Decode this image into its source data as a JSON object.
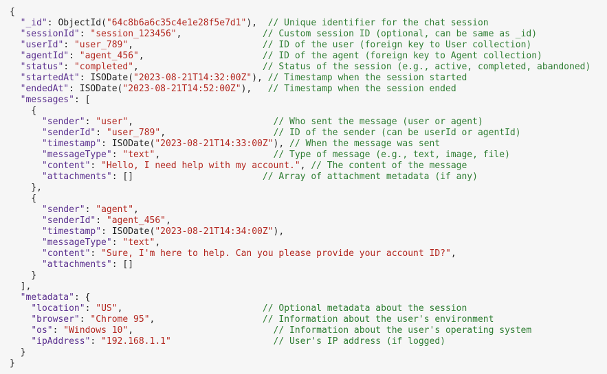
{
  "colors": {
    "background": "#f6f6f6",
    "punctuation": "#1f1f1f",
    "key": "#5a2f8e",
    "string": "#b3261e",
    "comment": "#2e7d32"
  },
  "code_lines": [
    [
      {
        "t": "{",
        "c": "p"
      }
    ],
    [
      {
        "t": "  ",
        "c": "p"
      },
      {
        "t": "\"_id\"",
        "c": "k"
      },
      {
        "t": ": ObjectId(",
        "c": "p"
      },
      {
        "t": "\"64c8b6a6c35c4e1e28f5e7d1\"",
        "c": "s"
      },
      {
        "t": "),  ",
        "c": "p"
      },
      {
        "t": "// Unique identifier for the chat session",
        "c": "c"
      }
    ],
    [
      {
        "t": "  ",
        "c": "p"
      },
      {
        "t": "\"sessionId\"",
        "c": "k"
      },
      {
        "t": ": ",
        "c": "p"
      },
      {
        "t": "\"session_123456\"",
        "c": "s"
      },
      {
        "t": ",               ",
        "c": "p"
      },
      {
        "t": "// Custom session ID (optional, can be same as _id)",
        "c": "c"
      }
    ],
    [
      {
        "t": "  ",
        "c": "p"
      },
      {
        "t": "\"userId\"",
        "c": "k"
      },
      {
        "t": ": ",
        "c": "p"
      },
      {
        "t": "\"user_789\"",
        "c": "s"
      },
      {
        "t": ",                        ",
        "c": "p"
      },
      {
        "t": "// ID of the user (foreign key to User collection)",
        "c": "c"
      }
    ],
    [
      {
        "t": "  ",
        "c": "p"
      },
      {
        "t": "\"agentId\"",
        "c": "k"
      },
      {
        "t": ": ",
        "c": "p"
      },
      {
        "t": "\"agent_456\"",
        "c": "s"
      },
      {
        "t": ",                      ",
        "c": "p"
      },
      {
        "t": "// ID of the agent (foreign key to Agent collection)",
        "c": "c"
      }
    ],
    [
      {
        "t": "  ",
        "c": "p"
      },
      {
        "t": "\"status\"",
        "c": "k"
      },
      {
        "t": ": ",
        "c": "p"
      },
      {
        "t": "\"completed\"",
        "c": "s"
      },
      {
        "t": ",                       ",
        "c": "p"
      },
      {
        "t": "// Status of the session (e.g., active, completed, abandoned)",
        "c": "c"
      }
    ],
    [
      {
        "t": "  ",
        "c": "p"
      },
      {
        "t": "\"startedAt\"",
        "c": "k"
      },
      {
        "t": ": ISODate(",
        "c": "p"
      },
      {
        "t": "\"2023-08-21T14:32:00Z\"",
        "c": "s"
      },
      {
        "t": "), ",
        "c": "p"
      },
      {
        "t": "// Timestamp when the session started",
        "c": "c"
      }
    ],
    [
      {
        "t": "  ",
        "c": "p"
      },
      {
        "t": "\"endedAt\"",
        "c": "k"
      },
      {
        "t": ": ISODate(",
        "c": "p"
      },
      {
        "t": "\"2023-08-21T14:52:00Z\"",
        "c": "s"
      },
      {
        "t": "),   ",
        "c": "p"
      },
      {
        "t": "// Timestamp when the session ended",
        "c": "c"
      }
    ],
    [
      {
        "t": "  ",
        "c": "p"
      },
      {
        "t": "\"messages\"",
        "c": "k"
      },
      {
        "t": ": [",
        "c": "p"
      }
    ],
    [
      {
        "t": "    {",
        "c": "p"
      }
    ],
    [
      {
        "t": "      ",
        "c": "p"
      },
      {
        "t": "\"sender\"",
        "c": "k"
      },
      {
        "t": ": ",
        "c": "p"
      },
      {
        "t": "\"user\"",
        "c": "s"
      },
      {
        "t": ",                          ",
        "c": "p"
      },
      {
        "t": "// Who sent the message (user or agent)",
        "c": "c"
      }
    ],
    [
      {
        "t": "      ",
        "c": "p"
      },
      {
        "t": "\"senderId\"",
        "c": "k"
      },
      {
        "t": ": ",
        "c": "p"
      },
      {
        "t": "\"user_789\"",
        "c": "s"
      },
      {
        "t": ",                    ",
        "c": "p"
      },
      {
        "t": "// ID of the sender (can be userId or agentId)",
        "c": "c"
      }
    ],
    [
      {
        "t": "      ",
        "c": "p"
      },
      {
        "t": "\"timestamp\"",
        "c": "k"
      },
      {
        "t": ": ISODate(",
        "c": "p"
      },
      {
        "t": "\"2023-08-21T14:33:00Z\"",
        "c": "s"
      },
      {
        "t": "), ",
        "c": "p"
      },
      {
        "t": "// When the message was sent",
        "c": "c"
      }
    ],
    [
      {
        "t": "      ",
        "c": "p"
      },
      {
        "t": "\"messageType\"",
        "c": "k"
      },
      {
        "t": ": ",
        "c": "p"
      },
      {
        "t": "\"text\"",
        "c": "s"
      },
      {
        "t": ",                     ",
        "c": "p"
      },
      {
        "t": "// Type of message (e.g., text, image, file)",
        "c": "c"
      }
    ],
    [
      {
        "t": "      ",
        "c": "p"
      },
      {
        "t": "\"content\"",
        "c": "k"
      },
      {
        "t": ": ",
        "c": "p"
      },
      {
        "t": "\"Hello, I need help with my account.\"",
        "c": "s"
      },
      {
        "t": ", ",
        "c": "p"
      },
      {
        "t": "// The content of the message",
        "c": "c"
      }
    ],
    [
      {
        "t": "      ",
        "c": "p"
      },
      {
        "t": "\"attachments\"",
        "c": "k"
      },
      {
        "t": ": []                        ",
        "c": "p"
      },
      {
        "t": "// Array of attachment metadata (if any)",
        "c": "c"
      }
    ],
    [
      {
        "t": "    },",
        "c": "p"
      }
    ],
    [
      {
        "t": "    {",
        "c": "p"
      }
    ],
    [
      {
        "t": "      ",
        "c": "p"
      },
      {
        "t": "\"sender\"",
        "c": "k"
      },
      {
        "t": ": ",
        "c": "p"
      },
      {
        "t": "\"agent\"",
        "c": "s"
      },
      {
        "t": ",",
        "c": "p"
      }
    ],
    [
      {
        "t": "      ",
        "c": "p"
      },
      {
        "t": "\"senderId\"",
        "c": "k"
      },
      {
        "t": ": ",
        "c": "p"
      },
      {
        "t": "\"agent_456\"",
        "c": "s"
      },
      {
        "t": ",",
        "c": "p"
      }
    ],
    [
      {
        "t": "      ",
        "c": "p"
      },
      {
        "t": "\"timestamp\"",
        "c": "k"
      },
      {
        "t": ": ISODate(",
        "c": "p"
      },
      {
        "t": "\"2023-08-21T14:34:00Z\"",
        "c": "s"
      },
      {
        "t": "),",
        "c": "p"
      }
    ],
    [
      {
        "t": "      ",
        "c": "p"
      },
      {
        "t": "\"messageType\"",
        "c": "k"
      },
      {
        "t": ": ",
        "c": "p"
      },
      {
        "t": "\"text\"",
        "c": "s"
      },
      {
        "t": ",",
        "c": "p"
      }
    ],
    [
      {
        "t": "      ",
        "c": "p"
      },
      {
        "t": "\"content\"",
        "c": "k"
      },
      {
        "t": ": ",
        "c": "p"
      },
      {
        "t": "\"Sure, I'm here to help. Can you please provide your account ID?\"",
        "c": "s"
      },
      {
        "t": ",",
        "c": "p"
      }
    ],
    [
      {
        "t": "      ",
        "c": "p"
      },
      {
        "t": "\"attachments\"",
        "c": "k"
      },
      {
        "t": ": []",
        "c": "p"
      }
    ],
    [
      {
        "t": "    }",
        "c": "p"
      }
    ],
    [
      {
        "t": "  ],",
        "c": "p"
      }
    ],
    [
      {
        "t": "  ",
        "c": "p"
      },
      {
        "t": "\"metadata\"",
        "c": "k"
      },
      {
        "t": ": {",
        "c": "p"
      }
    ],
    [
      {
        "t": "    ",
        "c": "p"
      },
      {
        "t": "\"location\"",
        "c": "k"
      },
      {
        "t": ": ",
        "c": "p"
      },
      {
        "t": "\"US\"",
        "c": "s"
      },
      {
        "t": ",                          ",
        "c": "p"
      },
      {
        "t": "// Optional metadata about the session",
        "c": "c"
      }
    ],
    [
      {
        "t": "    ",
        "c": "p"
      },
      {
        "t": "\"browser\"",
        "c": "k"
      },
      {
        "t": ": ",
        "c": "p"
      },
      {
        "t": "\"Chrome 95\"",
        "c": "s"
      },
      {
        "t": ",                    ",
        "c": "p"
      },
      {
        "t": "// Information about the user's environment",
        "c": "c"
      }
    ],
    [
      {
        "t": "    ",
        "c": "p"
      },
      {
        "t": "\"os\"",
        "c": "k"
      },
      {
        "t": ": ",
        "c": "p"
      },
      {
        "t": "\"Windows 10\"",
        "c": "s"
      },
      {
        "t": ",                          ",
        "c": "p"
      },
      {
        "t": "// Information about the user's operating system",
        "c": "c"
      }
    ],
    [
      {
        "t": "    ",
        "c": "p"
      },
      {
        "t": "\"ipAddress\"",
        "c": "k"
      },
      {
        "t": ": ",
        "c": "p"
      },
      {
        "t": "\"192.168.1.1\"",
        "c": "s"
      },
      {
        "t": "                   ",
        "c": "p"
      },
      {
        "t": "// User's IP address (if logged)",
        "c": "c"
      }
    ],
    [
      {
        "t": "  }",
        "c": "p"
      }
    ],
    [
      {
        "t": "}",
        "c": "p"
      }
    ]
  ]
}
